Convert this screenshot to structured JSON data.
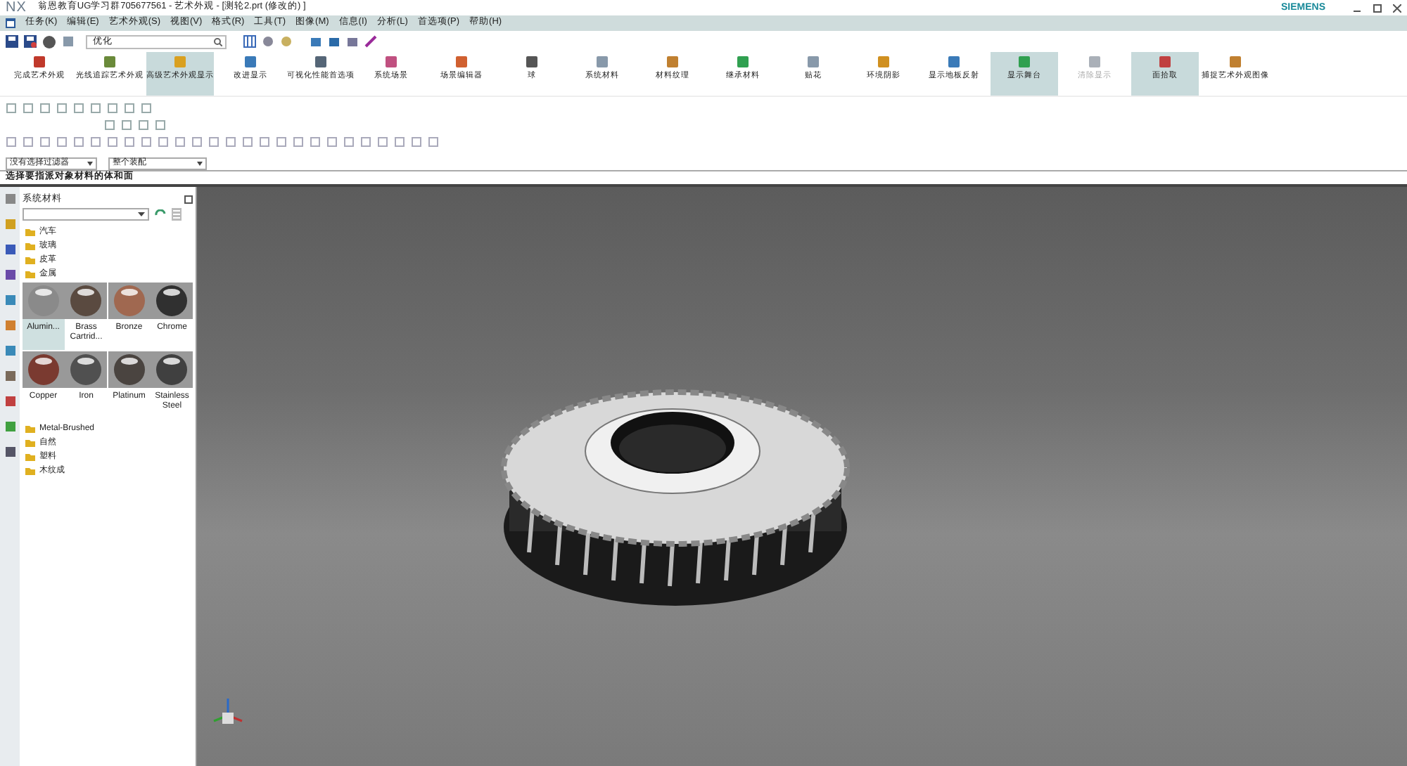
{
  "window": {
    "app": "NX",
    "title": "翁恩教育UG学习群705677561 - 艺术外观 - [测轮2.prt  (修改的) ]",
    "brand": "SIEMENS"
  },
  "menu": [
    "任务(K)",
    "编辑(E)",
    "艺术外观(S)",
    "视图(V)",
    "格式(R)",
    "工具(T)",
    "图像(M)",
    "信息(I)",
    "分析(L)",
    "首选项(P)",
    "帮助(H)"
  ],
  "search": {
    "value": "优化"
  },
  "ribbon": [
    {
      "label": "完成艺术外观",
      "selected": false,
      "disabled": false,
      "color": "#c0392b"
    },
    {
      "label": "光线追踪艺术外观",
      "selected": false,
      "disabled": false,
      "color": "#6a8a3a"
    },
    {
      "label": "高级艺术外观显示",
      "selected": true,
      "disabled": false,
      "color": "#d9a020"
    },
    {
      "label": "改进显示",
      "selected": false,
      "disabled": false,
      "color": "#3a7ab8"
    },
    {
      "label": "可视化性能首选项",
      "selected": false,
      "disabled": false,
      "color": "#556677"
    },
    {
      "label": "系统场景",
      "selected": false,
      "disabled": false,
      "color": "#c05080"
    },
    {
      "label": "场景编辑器",
      "selected": false,
      "disabled": false,
      "color": "#d06030"
    },
    {
      "label": "球",
      "selected": false,
      "disabled": false,
      "color": "#555555"
    },
    {
      "label": "系统材料",
      "selected": false,
      "disabled": false,
      "color": "#8899aa"
    },
    {
      "label": "材料纹理",
      "selected": false,
      "disabled": false,
      "color": "#c08030"
    },
    {
      "label": "继承材料",
      "selected": false,
      "disabled": false,
      "color": "#30a050"
    },
    {
      "label": "贴花",
      "selected": false,
      "disabled": false,
      "color": "#8899aa"
    },
    {
      "label": "环境阴影",
      "selected": false,
      "disabled": false,
      "color": "#d09020"
    },
    {
      "label": "显示地板反射",
      "selected": false,
      "disabled": false,
      "color": "#3a7ab8"
    },
    {
      "label": "显示舞台",
      "selected": true,
      "disabled": false,
      "color": "#30a050"
    },
    {
      "label": "清除显示",
      "selected": false,
      "disabled": true,
      "color": "#aab0b8"
    },
    {
      "label": "面拾取",
      "selected": true,
      "disabled": false,
      "color": "#c04040"
    },
    {
      "label": "捕捉艺术外观图像",
      "selected": false,
      "disabled": false,
      "color": "#c08030"
    }
  ],
  "filters": [
    {
      "value": "没有选择过滤器"
    },
    {
      "value": "整个装配"
    }
  ],
  "cue_line": "选择要指派对象材料的体和面",
  "panel": {
    "title": "系统材料",
    "folders_before": [
      "汽车",
      "玻璃",
      "皮革",
      "金属"
    ],
    "materials": [
      {
        "label": "Alumin...",
        "selected": true,
        "color": "#8a8a8a"
      },
      {
        "label": "Brass Cartrid...",
        "selected": false,
        "color": "#5a4a40"
      },
      {
        "label": "Bronze",
        "selected": false,
        "color": "#a06850"
      },
      {
        "label": "Chrome",
        "selected": false,
        "color": "#303030"
      },
      {
        "label": "Copper",
        "selected": false,
        "color": "#7a3a30"
      },
      {
        "label": "Iron",
        "selected": false,
        "color": "#505050"
      },
      {
        "label": "Platinum",
        "selected": false,
        "color": "#4a4440"
      },
      {
        "label": "Stainless Steel",
        "selected": false,
        "color": "#404040"
      }
    ],
    "folders_after": [
      "Metal-Brushed",
      "自然",
      "塑料",
      "木纹成"
    ]
  }
}
